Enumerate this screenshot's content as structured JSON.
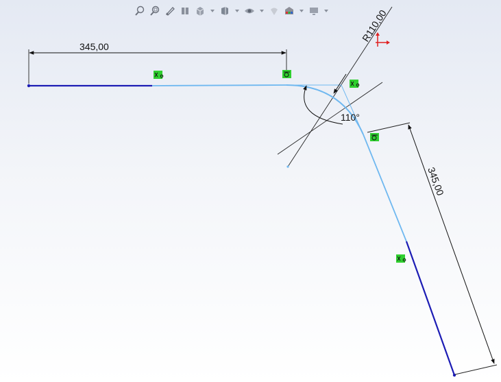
{
  "toolbar": {
    "items": [
      {
        "icon": "zoom-to-fit-icon"
      },
      {
        "icon": "zoom-area-icon"
      },
      {
        "icon": "previous-view-icon"
      },
      {
        "icon": "section-view-icon"
      },
      {
        "icon": "view-orientation-icon",
        "dropdown": true
      },
      {
        "icon": "display-style-icon",
        "dropdown": true
      },
      {
        "icon": "hide-show-items-icon",
        "dropdown": true
      },
      {
        "icon": "edit-appearance-icon"
      },
      {
        "icon": "apply-scene-icon",
        "dropdown": true
      },
      {
        "icon": "view-settings-icon",
        "dropdown": true
      }
    ]
  },
  "sketch": {
    "dim_top_length": "345,00",
    "dim_angle": "110°",
    "dim_radius": "R110,00",
    "dim_slant_length": "345,00",
    "colors": {
      "fully_defined": "#1c1cb4",
      "selected": "#6fb8f0",
      "dimension": "#111111",
      "relation_tag": "#2fcf2f",
      "origin_axis": "#e02020"
    }
  }
}
